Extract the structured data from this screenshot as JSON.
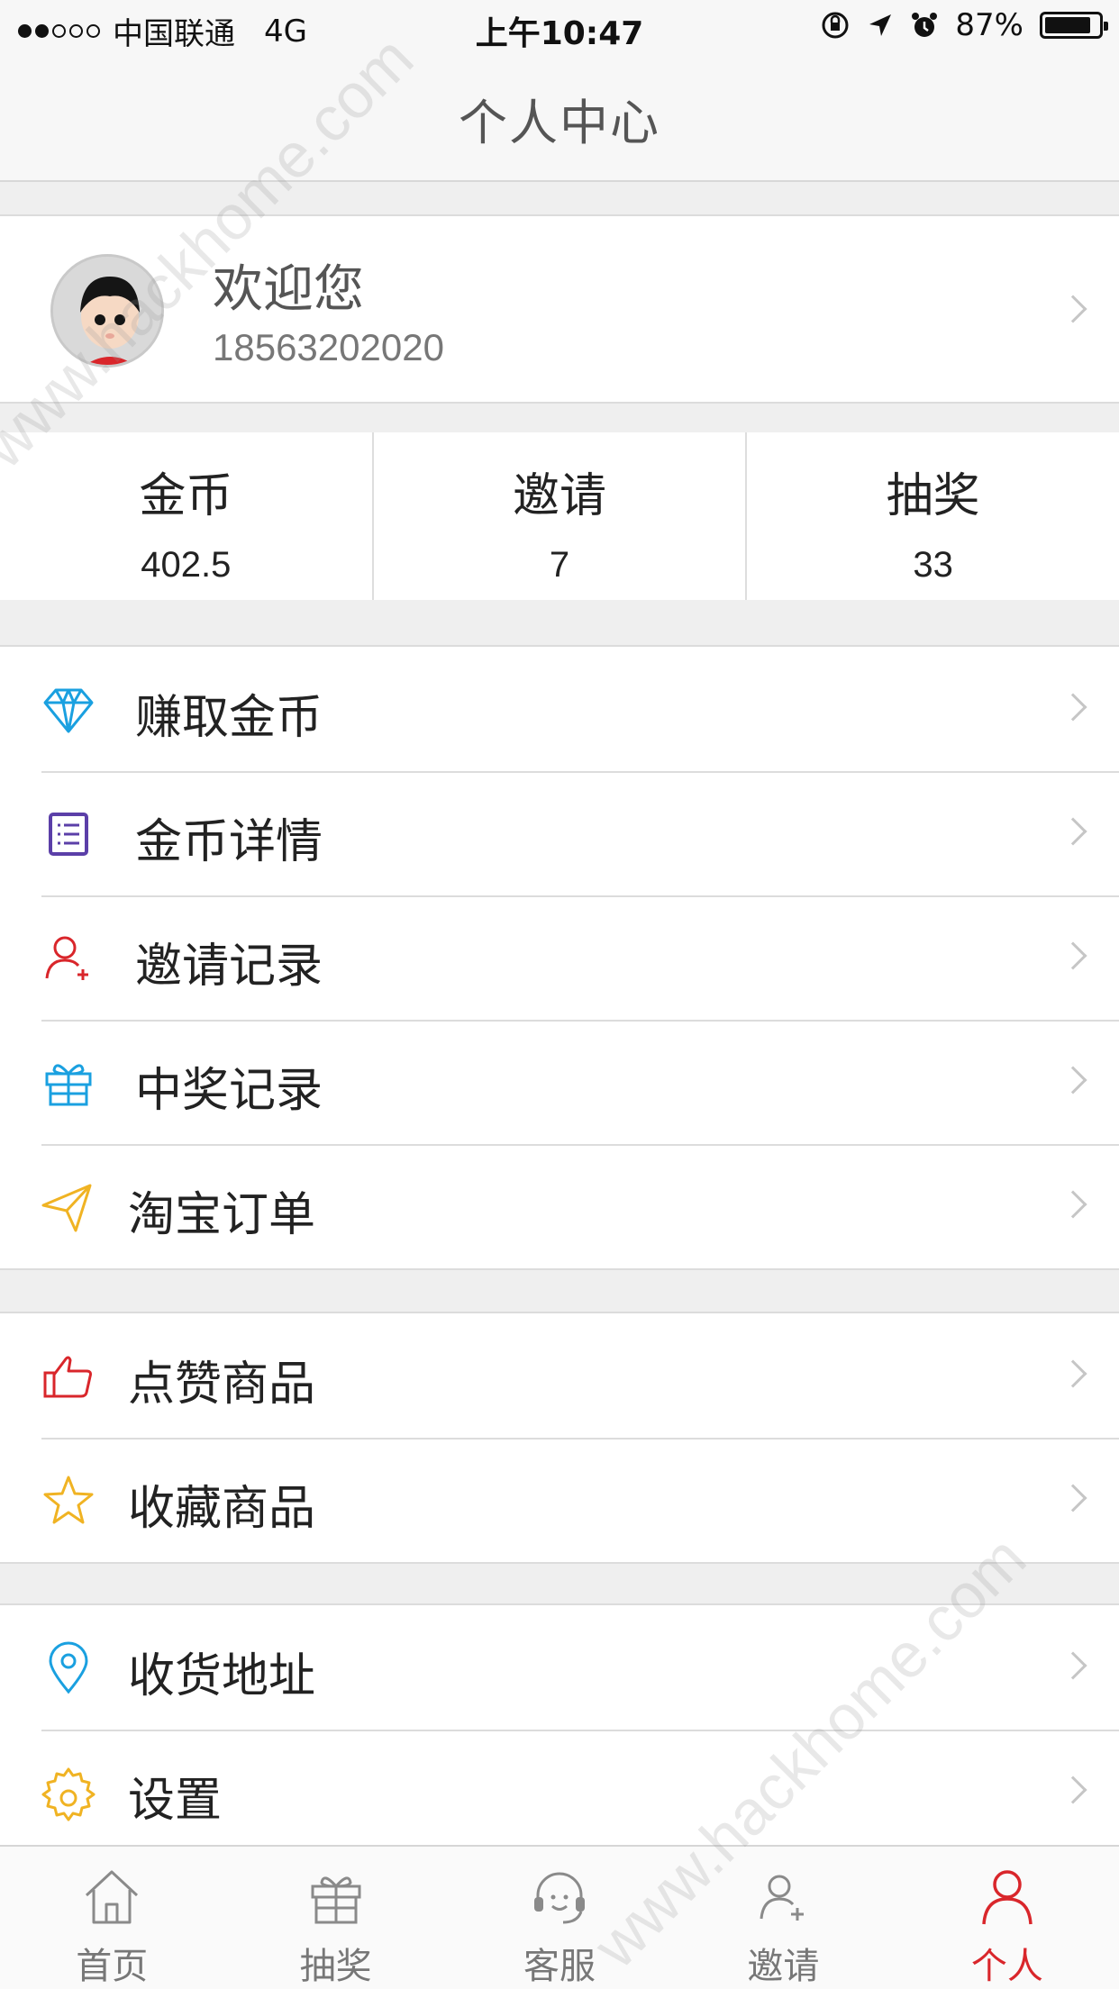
{
  "status_bar": {
    "carrier": "中国联通",
    "network": "4G",
    "time": "上午10:47",
    "battery": "87%",
    "battery_level": 0.87
  },
  "nav": {
    "title": "个人中心"
  },
  "profile": {
    "welcome": "欢迎您",
    "phone": "18563202020"
  },
  "stats": [
    {
      "label": "金币",
      "value": "402.5"
    },
    {
      "label": "邀请",
      "value": "7"
    },
    {
      "label": "抽奖",
      "value": "33"
    }
  ],
  "menu_group_1": [
    {
      "label": "赚取金币",
      "icon": "diamond-icon",
      "color": "#1aa0e0"
    },
    {
      "label": "金币详情",
      "icon": "list-icon",
      "color": "#5b3fa8"
    },
    {
      "label": "邀请记录",
      "icon": "add-user-icon",
      "color": "#d9262b"
    },
    {
      "label": "中奖记录",
      "icon": "gift-icon",
      "color": "#1aa0e0"
    },
    {
      "label": "淘宝订单",
      "icon": "paper-plane-icon",
      "color": "#f0b323"
    }
  ],
  "menu_group_2": [
    {
      "label": "点赞商品",
      "icon": "thumbs-up-icon",
      "color": "#d9262b"
    },
    {
      "label": "收藏商品",
      "icon": "star-icon",
      "color": "#f0b323"
    }
  ],
  "menu_group_3": [
    {
      "label": "收货地址",
      "icon": "location-pin-icon",
      "color": "#1aa0e0"
    },
    {
      "label": "设置",
      "icon": "gear-icon",
      "color": "#f0b323"
    }
  ],
  "tabs": [
    {
      "label": "首页",
      "icon": "home-icon"
    },
    {
      "label": "抽奖",
      "icon": "gift-icon"
    },
    {
      "label": "客服",
      "icon": "headset-icon"
    },
    {
      "label": "邀请",
      "icon": "add-user-icon"
    },
    {
      "label": "个人",
      "icon": "person-icon",
      "active": true
    }
  ],
  "colors": {
    "accent": "#d9262b",
    "background": "#efefef"
  },
  "watermark": "www.hackhome.com"
}
